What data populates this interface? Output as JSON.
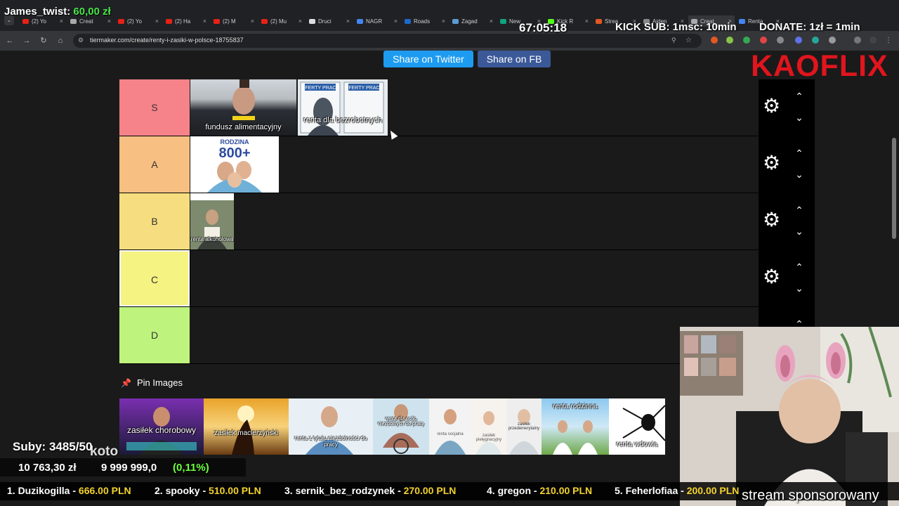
{
  "overlay": {
    "streamer": "James_twist:",
    "streamer_money": "60,00 zł",
    "timer": "67:05:18",
    "kick_sub": "KICK SUB: 1msc: 10min",
    "donate": "DONATE: 1zł = 1min",
    "brand": "KAOFLIX",
    "subs": "Suby: 3485/50",
    "koto": "koto",
    "goal_current": "10 763,30 zł",
    "goal_total": "9 999 999,0",
    "goal_pct": "(0,11%)",
    "ticker": [
      {
        "rank": "1. Duzikogilla - ",
        "amount": "666.00 PLN"
      },
      {
        "rank": "2. spooky - ",
        "amount": "510.00 PLN"
      },
      {
        "rank": "3. sernik_bez_rodzynek - ",
        "amount": "270.00 PLN"
      },
      {
        "rank": "4. gregon - ",
        "amount": "210.00 PLN"
      },
      {
        "rank": "5. Feherlofiaa - ",
        "amount": "200.00 PLN"
      }
    ],
    "sponsor": "stream sponsorowany"
  },
  "browser": {
    "url": "tiermaker.com/create/renty-i-zasiki-w-polsce-18755837",
    "tabs": [
      "(2) Yo",
      "Creat",
      "(2) Yo",
      "(2) Ha",
      "(2) M",
      "(2) Mu",
      "Druci",
      "NAGR",
      "Roads",
      "Zagad",
      "New",
      "Kick R",
      "Strea",
      "Aiden",
      "Creat",
      "Renta"
    ]
  },
  "page": {
    "share_twitter": "Share on Twitter",
    "share_fb": "Share on FB",
    "tiers": [
      {
        "label": "S",
        "color": "#f7838a"
      },
      {
        "label": "A",
        "color": "#f7bf82"
      },
      {
        "label": "B",
        "color": "#f6de80"
      },
      {
        "label": "C",
        "color": "#f5f381"
      },
      {
        "label": "D",
        "color": "#bef47d"
      }
    ],
    "items": {
      "s1": "fundusz alimentacyjny",
      "s2": "renta dla bezrobotnych",
      "a1": "800+",
      "a1_top": "RODZINA",
      "b1": "renta alkoholowa"
    },
    "pin_title": "Pin Images",
    "pins": [
      "zasiłek chorobowy",
      "zasiłek macierzyński",
      "renta z tytułu niezdolności do pracy",
      "renta dla osób niezdolnych do pracy",
      "renta socjalna",
      "zasiłek pielęgnacyjny",
      "zasiłek przedemerytalny",
      "renta rodzinna",
      "renta wdowia"
    ]
  }
}
